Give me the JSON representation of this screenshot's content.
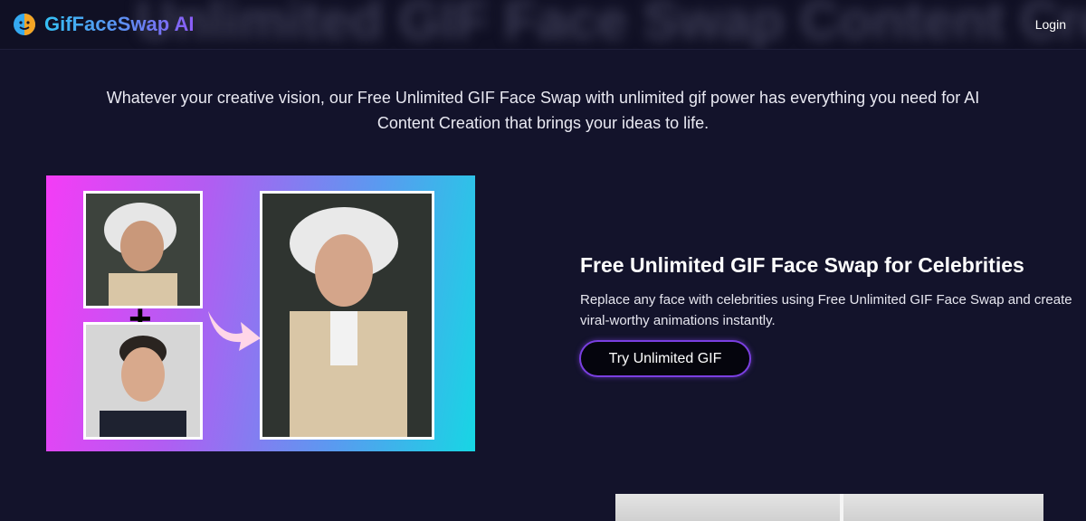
{
  "header": {
    "brand": "GifFaceSwap AI",
    "logo_icon": "smiley-face-icon",
    "ghost_heading": "Unlimited GIF Face Swap Content Creation",
    "login_label": "Login"
  },
  "intro": {
    "text": "Whatever your creative vision, our Free Unlimited GIF Face Swap with unlimited gif power has everything you need for AI Content Creation that brings your ideas to life."
  },
  "feature": {
    "title": "Free Unlimited GIF Face Swap for Celebrities",
    "description": "Replace any face with celebrities using Free Unlimited GIF Face Swap and create viral-worthy animations instantly.",
    "cta_label": "Try Unlimited GIF"
  },
  "hero_image": {
    "plus_symbol": "+"
  },
  "colors": {
    "background": "#13132b",
    "accent": "#7a3fe0",
    "brand_gradient_start": "#35c0f4",
    "brand_gradient_end": "#8b5cf6"
  }
}
